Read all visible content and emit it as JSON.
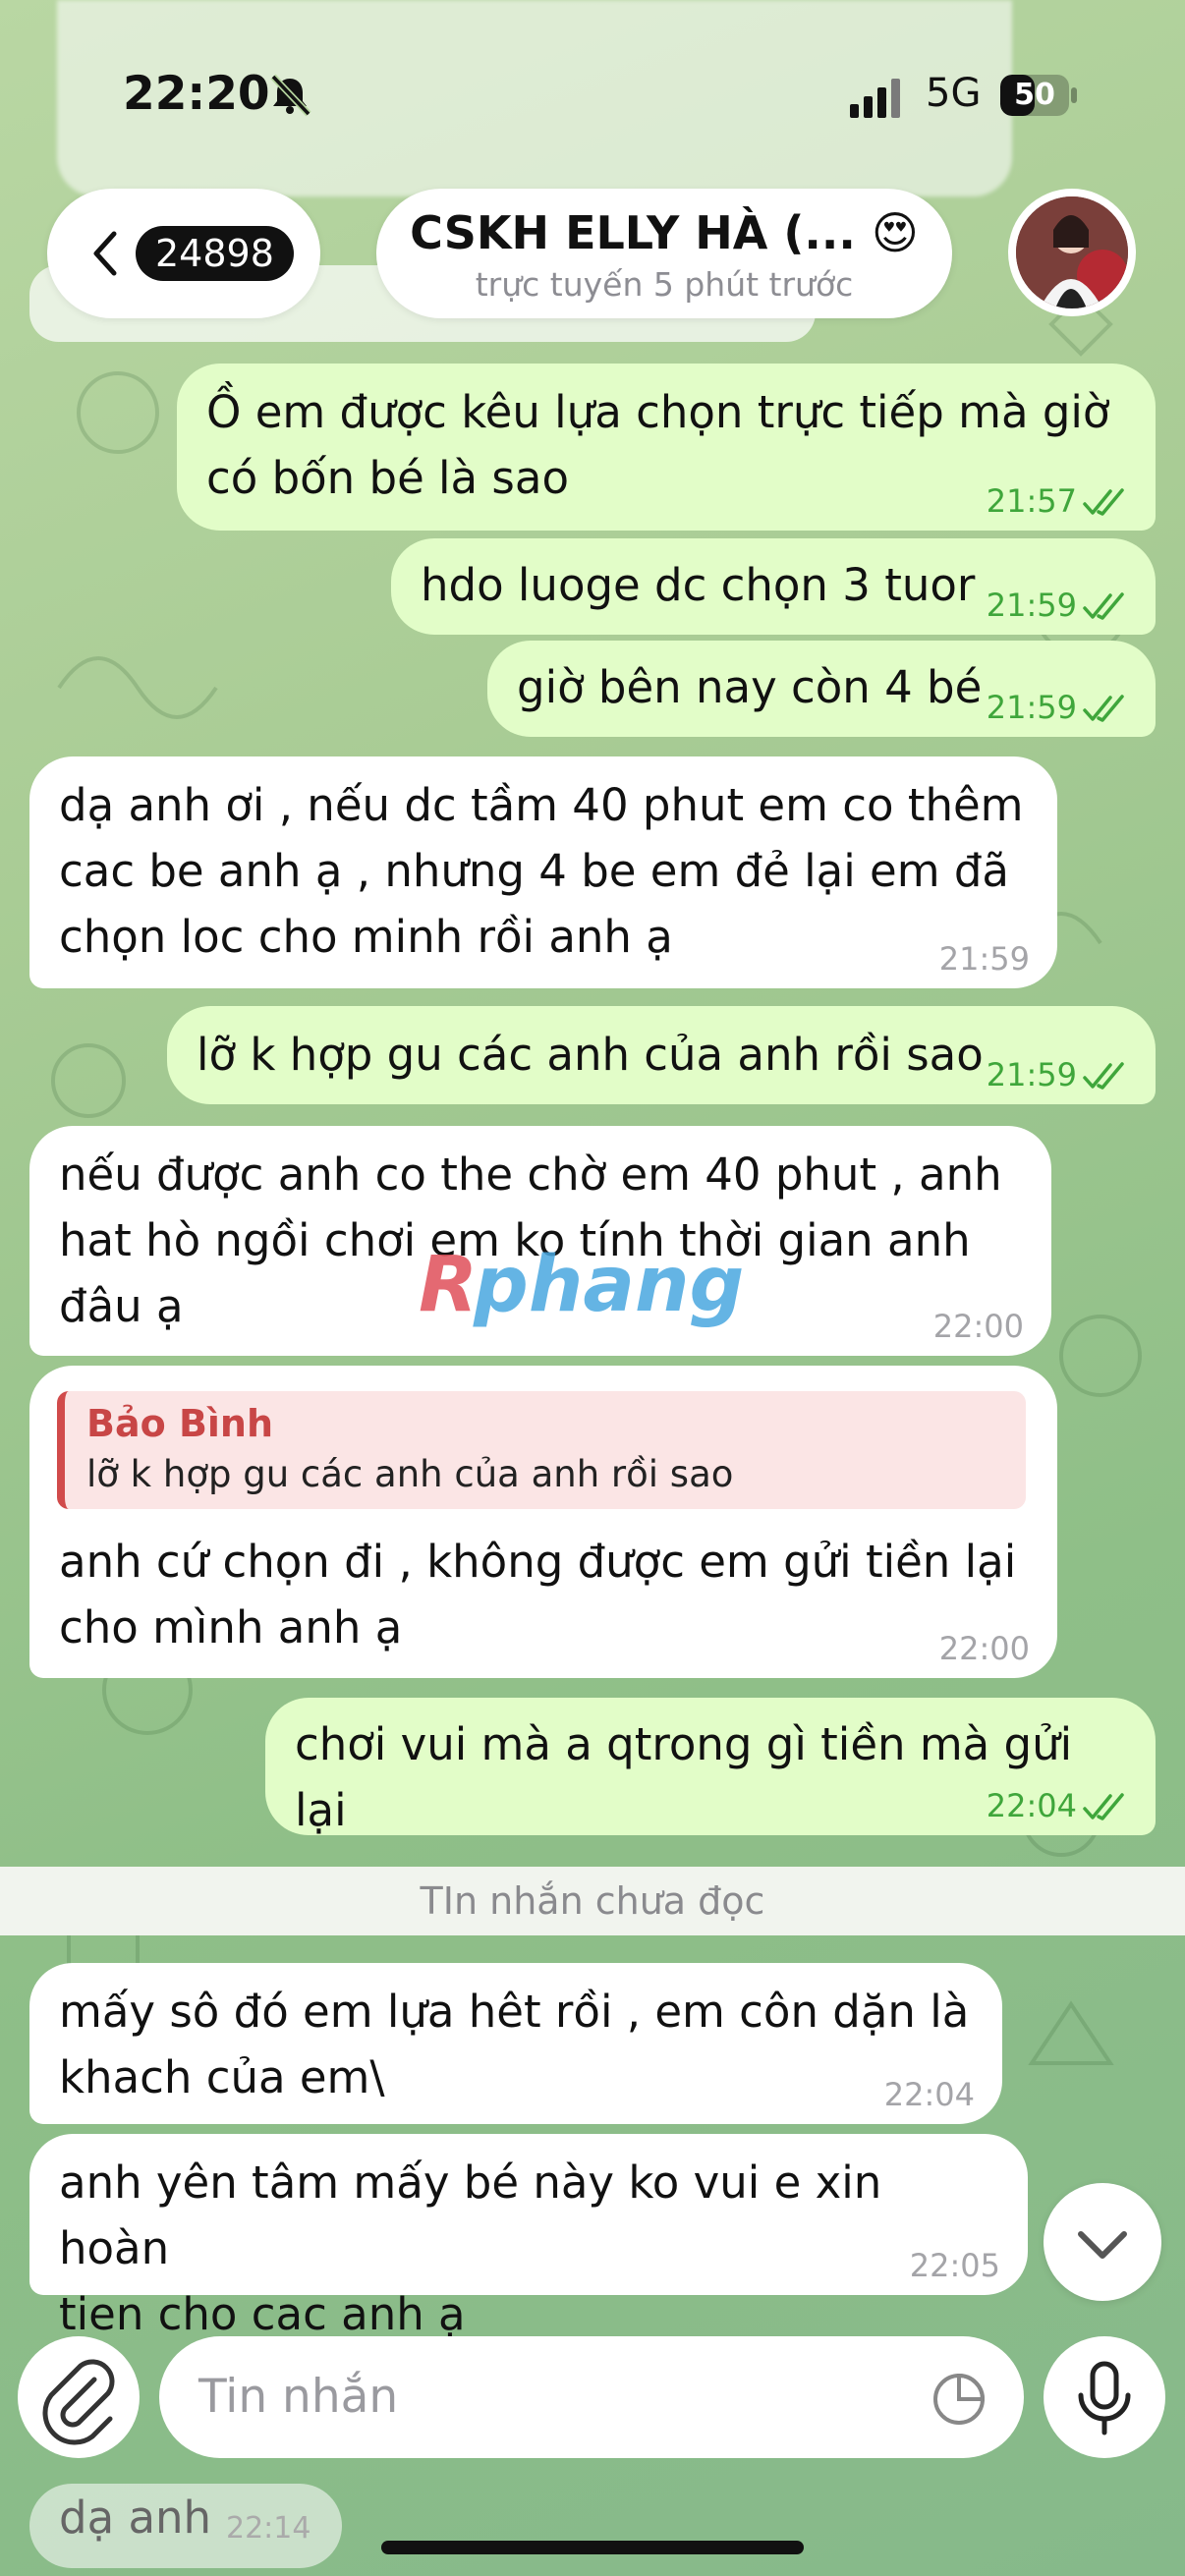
{
  "status_bar": {
    "time": "22:20",
    "network": "5G",
    "battery_level": "50"
  },
  "header": {
    "back_count": "24898",
    "chat_name": "CSKH ELLY HÀ (... 😍",
    "chat_status": "trực tuyến 5 phút trước"
  },
  "messages": [
    {
      "dir": "out",
      "text": "Ồ em được kêu lựa chọn trực tiếp mà giờ\ncó bốn bé là sao",
      "time": "21:57"
    },
    {
      "dir": "out",
      "text": "hdo luoge dc chọn 3 tuor",
      "time": "21:59"
    },
    {
      "dir": "out",
      "text": "giờ bên nay còn 4 bé",
      "time": "21:59"
    },
    {
      "dir": "in",
      "text": "dạ anh ơi , nếu dc tầm 40 phut em co thêm\ncac be anh ạ , nhưng 4 be em đẻ lại em đã\nchọn loc cho minh rồi anh ạ",
      "time": "21:59"
    },
    {
      "dir": "out",
      "text": "lỡ k hợp gu các anh của anh rồi sao",
      "time": "21:59"
    },
    {
      "dir": "in",
      "text": "nếu được anh co the chờ em 40 phut , anh\nhat hò ngồi chơi em ko tính thời gian anh\nđâu ạ",
      "time": "22:00"
    },
    {
      "dir": "in",
      "reply_name": "Bảo Bình",
      "reply_text": "lỡ k hợp gu các anh của anh rồi sao",
      "text": "anh cứ chọn đi , không được em gửi tiền lại\ncho mình anh ạ",
      "time": "22:00"
    },
    {
      "dir": "out",
      "text": "chơi vui mà a qtrong gì tiền mà gửi lại",
      "time": "22:04"
    },
    {
      "dir": "in",
      "text": "mấy sô đó em lựa hêt rồi , em côn dặn là\nkhach của em\\",
      "time": "22:04"
    },
    {
      "dir": "in",
      "text": "anh yên tâm mấy bé này ko vui e xin hoàn\ntien cho cac anh ạ",
      "time": "22:05"
    }
  ],
  "unread_divider": "TIn nhắn chưa đọc",
  "composer": {
    "placeholder": "Tin nhắn"
  },
  "last_message": {
    "text": "dạ anh",
    "time": "22:14"
  },
  "watermark": "Rphang",
  "colors": {
    "outgoing_bubble": "#e2fdc8",
    "incoming_bubble": "#ffffff",
    "check_green": "#3fa63b",
    "reply_accent": "#d14b4b"
  }
}
